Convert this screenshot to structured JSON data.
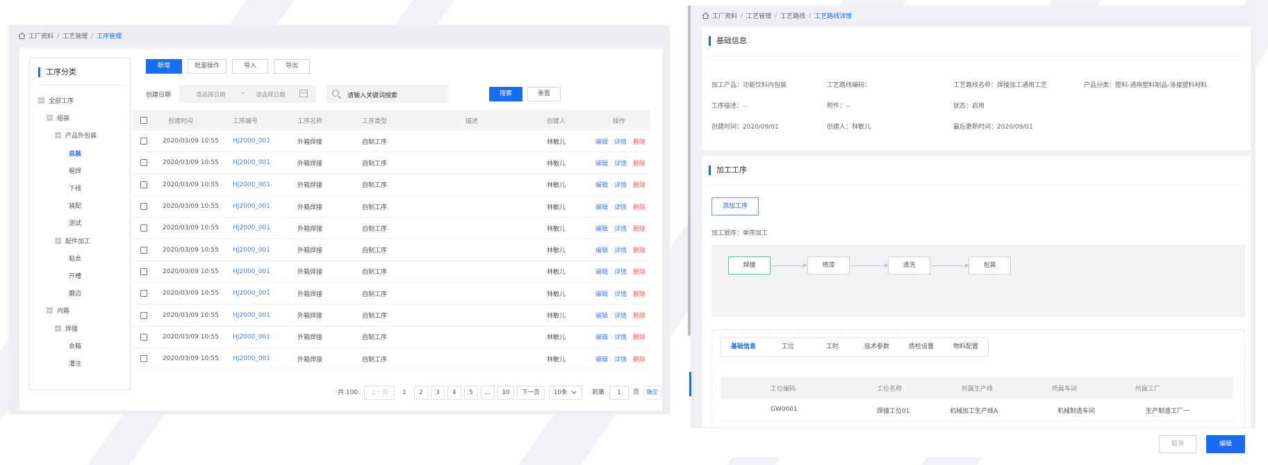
{
  "left": {
    "breadcrumb": [
      "工厂资料",
      "工艺管理",
      "工序管理"
    ],
    "tree": {
      "title": "工序分类",
      "nodes": [
        {
          "label": "全部工序",
          "level": 0,
          "box": true
        },
        {
          "label": "组装",
          "level": 1,
          "box": true
        },
        {
          "label": "产品外包装",
          "level": 2,
          "box": true
        },
        {
          "label": "总装",
          "level": 3,
          "active": true
        },
        {
          "label": "租焊",
          "level": 3
        },
        {
          "label": "下线",
          "level": 3
        },
        {
          "label": "装配",
          "level": 3
        },
        {
          "label": "测试",
          "level": 3
        },
        {
          "label": "配件加工",
          "level": 2,
          "box": true
        },
        {
          "label": "粘合",
          "level": 3
        },
        {
          "label": "开槽",
          "level": 3
        },
        {
          "label": "磨边",
          "level": 3
        },
        {
          "label": "内箱",
          "level": 1,
          "box": true
        },
        {
          "label": "焊接",
          "level": 2,
          "box": true
        },
        {
          "label": "合箱",
          "level": 3
        },
        {
          "label": "灌注",
          "level": 3
        }
      ]
    },
    "toolbar": {
      "new": "新增",
      "batch": "批量操作",
      "import": "导入",
      "export": "导出"
    },
    "filter": {
      "date_label": "创建日期",
      "start_placeholder": "请选择日期",
      "range_sep": "~",
      "end_placeholder": "请选择日期",
      "search_placeholder": "请输入关键词搜索",
      "search_btn": "搜索",
      "reset_btn": "重置"
    },
    "table": {
      "headers": [
        "创建时间",
        "工序编号",
        "工序名称",
        "工序类型",
        "描述",
        "创建人",
        "操作"
      ],
      "rows": [
        {
          "time": "2020/03/09 10:55",
          "code": "HJ2000_001",
          "name": "外箱焊接",
          "type": "自制工序",
          "desc": "",
          "creator": "林敏儿"
        },
        {
          "time": "2020/03/09 10:55",
          "code": "HJ2000_001",
          "name": "外箱焊接",
          "type": "自制工序",
          "desc": "",
          "creator": "林敏儿"
        },
        {
          "time": "2020/03/09 10:55",
          "code": "HJ2000_001",
          "name": "外箱焊接",
          "type": "自制工序",
          "desc": "",
          "creator": "林敏儿"
        },
        {
          "time": "2020/03/09 10:55",
          "code": "HJ2000_001",
          "name": "外箱焊接",
          "type": "自制工序",
          "desc": "",
          "creator": "林敏儿"
        },
        {
          "time": "2020/03/09 10:55",
          "code": "HJ2000_001",
          "name": "外箱焊接",
          "type": "自制工序",
          "desc": "",
          "creator": "林敏儿"
        },
        {
          "time": "2020/03/09 10:55",
          "code": "HJ2000_001",
          "name": "外箱焊接",
          "type": "自制工序",
          "desc": "",
          "creator": "林敏儿"
        },
        {
          "time": "2020/03/09 10:55",
          "code": "HJ2000_001",
          "name": "外箱焊接",
          "type": "自制工序",
          "desc": "",
          "creator": "林敏儿"
        },
        {
          "time": "2020/03/09 10:55",
          "code": "HJ2000_001",
          "name": "外箱焊接",
          "type": "自制工序",
          "desc": "",
          "creator": "林敏儿"
        },
        {
          "time": "2020/03/09 10:55",
          "code": "HJ2000_001",
          "name": "外箱焊接",
          "type": "自制工序",
          "desc": "",
          "creator": "林敏儿"
        },
        {
          "time": "2020/03/09 10:55",
          "code": "HJ2000_001",
          "name": "外箱焊接",
          "type": "自制工序",
          "desc": "",
          "creator": "林敏儿"
        },
        {
          "time": "2020/03/09 10:55",
          "code": "HJ2000_001",
          "name": "外箱焊接",
          "type": "自制工序",
          "desc": "",
          "creator": "林敏儿"
        }
      ],
      "ops": {
        "edit": "编辑",
        "detail": "详情",
        "delete": "删除"
      }
    },
    "pagination": {
      "total": "共 100",
      "prev": "上一页",
      "page1": "1",
      "p2": "2",
      "p3": "3",
      "p4": "4",
      "p5": "5",
      "ellipsis": "...",
      "p10": "10",
      "next": "下一页",
      "size": "10条",
      "goto": "到第",
      "goto_value": "1",
      "page_unit": "页",
      "confirm": "确定"
    }
  },
  "right": {
    "breadcrumb": [
      "工厂资料",
      "工艺管理",
      "工艺路线",
      "工艺路线详情"
    ],
    "basic": {
      "title": "基础信息",
      "fields": {
        "product": "加工产品：功能饮料内包装",
        "route_code": "工艺路线编码：",
        "route_name": "工艺路线名称：焊接加工通用工艺",
        "category": "产品分类：塑料-通用塑料制品-涤接塑料材料",
        "desc": "工序描述：--",
        "attachment": "附件：--",
        "status": "状态：启用",
        "created": "创建时间：2020/09/01",
        "creator": "创建人：林敏儿",
        "updated": "最后更新时间：2020/09/01"
      }
    },
    "process": {
      "title": "加工工序",
      "add_btn": "添加工序",
      "order": "加工顺序：单序加工",
      "flow": [
        "焊接",
        "喷漆",
        "清洗",
        "包装"
      ],
      "tabs": [
        "基础信息",
        "工位",
        "工时",
        "技术参数",
        "质检设置",
        "物料配置"
      ],
      "headers": [
        "工位编码",
        "工位名称",
        "所属生产线",
        "所属车间",
        "所属工厂"
      ],
      "row": {
        "code": "GW0001",
        "name": "焊接工位01",
        "line": "机械加工生产线A",
        "shop": "机械制造车间",
        "factory": "生产制造工厂一"
      }
    },
    "footer": {
      "cancel": "取消",
      "edit": "编辑"
    }
  }
}
